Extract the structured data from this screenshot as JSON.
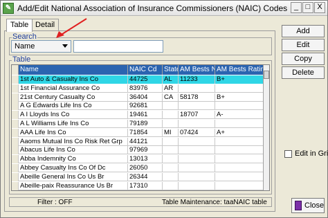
{
  "window": {
    "title": "Add/Edit National Association of Insurance Commissioners (NAIC) Codes"
  },
  "controls": {
    "minimize": "_",
    "maximize": "□",
    "close": "X"
  },
  "tabs": [
    {
      "label": "Table"
    },
    {
      "label": "Detail"
    }
  ],
  "search": {
    "group_label": "Search",
    "field_selected": "Name",
    "value": ""
  },
  "table": {
    "group_label": "Table",
    "columns": [
      "Name",
      "NAIC Cd",
      "State",
      "AM Bests Nbr",
      "AM Bests Rating"
    ],
    "rows": [
      [
        "1st Auto & Casualty Ins Co",
        "44725",
        "AL",
        "11233",
        "B+"
      ],
      [
        "1st Financial Assurance Co",
        "83976",
        "AR",
        "",
        ""
      ],
      [
        "21st Century Casualty Co",
        "36404",
        "CA",
        "58178",
        "B+"
      ],
      [
        "A G Edwards Life Ins Co",
        "92681",
        "",
        "",
        ""
      ],
      [
        "A I Lloyds Ins Co",
        "19461",
        "",
        "18707",
        "A-"
      ],
      [
        "A L Williams Life Ins Co",
        "79189",
        "",
        "",
        ""
      ],
      [
        "AAA Life Ins Co",
        "71854",
        "MI",
        "07424",
        "A+"
      ],
      [
        "Aaoms Mutual Ins Co Risk Ret Grp",
        "44121",
        "",
        "",
        ""
      ],
      [
        "Abacus Life Ins Co",
        "97969",
        "",
        "",
        ""
      ],
      [
        "Abba Indemnity Co",
        "13013",
        "",
        "",
        ""
      ],
      [
        "Abbey Casualty Ins Co Of Dc",
        "26050",
        "",
        "",
        ""
      ],
      [
        "Abeille General Ins Co Us Br",
        "26344",
        "",
        "",
        ""
      ],
      [
        "Abeille-paix Reassurance Us Br",
        "17310",
        "",
        "",
        ""
      ]
    ],
    "selected_row": 0
  },
  "status": {
    "filter": "Filter : OFF",
    "maintenance": "Table Maintenance:  taaNAIC  table"
  },
  "buttons": {
    "add": "Add",
    "edit": "Edit",
    "copy": "Copy",
    "delete": "Delete",
    "edit_in_grid": "Edit in Grid",
    "close": "Close"
  },
  "colors": {
    "header_bg": "#2b64b0",
    "selected_row": "#2fd6e6",
    "arrow": "#e02020"
  }
}
